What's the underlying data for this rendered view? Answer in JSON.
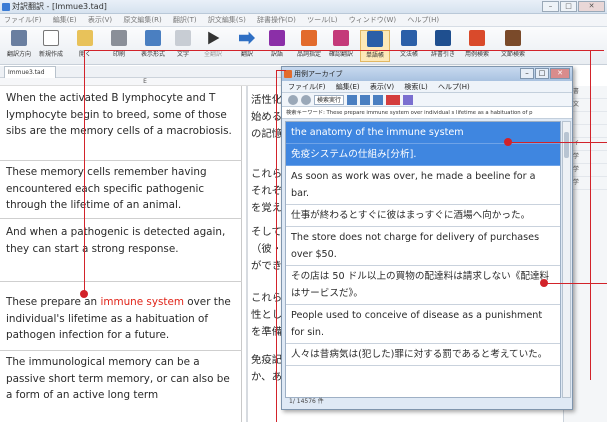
{
  "window": {
    "title": "対訳翻訳 - [Immue3.tad]"
  },
  "menubar": [
    "ファイル(F)",
    "編集(E)",
    "表示(V)",
    "原文編集(R)",
    "翻訳(T)",
    "訳文編集(S)",
    "辞書操作(D)",
    "ツール(L)",
    "ウィンドウ(W)",
    "ヘルプ(H)"
  ],
  "toolbar": [
    {
      "label": "翻訳方向"
    },
    {
      "label": "新規作成"
    },
    {
      "label": "開く"
    },
    {
      "label": "印刷"
    },
    {
      "label": "表示形式"
    },
    {
      "label": "文字"
    },
    {
      "label": "全翻訳"
    },
    {
      "label": "翻訳"
    },
    {
      "label": "訳語"
    },
    {
      "label": "品詞指定"
    },
    {
      "label": "確認翻訳"
    },
    {
      "label": "単語帳"
    },
    {
      "label": "文法帳"
    },
    {
      "label": "辞書引き"
    },
    {
      "label": "用例検索"
    },
    {
      "label": "文節検索"
    }
  ],
  "doc_tab": "Immue3.tad",
  "ruler_marker": "E",
  "english_segments": [
    {
      "text": "When the activated B lymphocyte and T lymphocyte begin to breed, some of those sibs are the memory cells of a macrobiosis."
    },
    {
      "text": "These memory cells remember having encountered each specific pathogenic through the lifetime of an animal."
    },
    {
      "text": "And when a pathogenic is detected again, they can start a strong response."
    },
    {
      "before": "These prepare an ",
      "highlight": "immune system",
      "after": " over the individual's lifetime as a habituation of pathogen infection for a future."
    },
    {
      "text": "The immunological memory can be a passive short term memory, or can also be a form of an active long term"
    }
  ],
  "japanese_fragments": [
    "活性化",
    "始める",
    "の記憶",
    "これら",
    "それぞ",
    "を覚え",
    "そして",
    "（彼・",
    "ができ",
    "これら",
    "性とし",
    "を準備",
    "免疫記",
    "か、あ"
  ],
  "dict_window": {
    "title": "用例アーカイブ",
    "menu": [
      "ファイル(F)",
      "編集(E)",
      "表示(V)",
      "検索(L)",
      "ヘルプ(H)"
    ],
    "exec_label": "検索実行",
    "keyword_line": "検索キーワード: These prepare immune system over individual s lifetime as a habituation of p",
    "entries": [
      {
        "en": "the anatomy of the immune system",
        "ja": "免疫システムの仕組み[分析]."
      },
      {
        "en": "As soon as work was over, he made a beeline for a bar.",
        "ja": "仕事が終わるとすぐに彼はまっすぐに酒場へ向かった。"
      },
      {
        "en": "The store does not charge for delivery of purchases over $50.",
        "ja": "その店は 50 ドル以上の買物の配達料は請求しない《配達料はサービスだ》。"
      },
      {
        "en": "People used to conceive of disease as a punishment for sin.",
        "ja": "人々は昔病気は(犯した)罪に対する罰であると考えていた。"
      }
    ],
    "status": "1/ 14576 件"
  },
  "side_panel": [
    "辞書",
    "原文",
    "標",
    "簿",
    "（イ",
    "医学",
    "医学",
    "医学"
  ],
  "colors": {
    "highlight": "#e0251a",
    "callout": "#d2232a",
    "selected_row": "#3f86e0"
  }
}
